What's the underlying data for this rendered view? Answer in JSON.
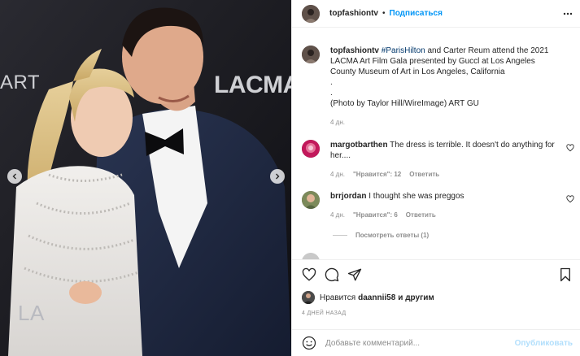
{
  "post": {
    "author": "topfashiontv",
    "follow_label": "Подписаться",
    "separator": "•",
    "caption_user": "topfashiontv",
    "caption_tag": "#ParisHilton",
    "caption_text": " and Carter Reum attend the 2021 LACMA Art Film Gala presented by Guccl at Los Angeles County Museum of Art in Los Angeles, California",
    "caption_dot1": ".",
    "caption_dot2": ".",
    "caption_credit": "(Photo by Taylor Hill/WireImage) ART GU",
    "caption_time": "4 дн.",
    "photo_wall_left": "ART",
    "photo_wall_right": "LACMA",
    "photo_wall_bottom": "LA"
  },
  "comments": [
    {
      "user": "margotbarthen",
      "text": "The dress is terrible. It doesn't do anything for her....",
      "time": "4 дн.",
      "likes": "\"Нравится\": 12",
      "reply": "Ответить"
    },
    {
      "user": "brrjordan",
      "text": "I thought she was preggos",
      "time": "4 дн.",
      "likes": "\"Нравится\": 6",
      "reply": "Ответить"
    }
  ],
  "view_replies": "Посмотреть ответы (1)",
  "likes_bar": {
    "prefix": "Нравится",
    "user": "daannii58",
    "suffix": "и другим"
  },
  "date_label": "4 ДНЕЙ НАЗАД",
  "comment_box": {
    "placeholder": "Добавьте комментарий...",
    "publish_label": "Опубликовать"
  },
  "icons": {
    "like": "heart-icon",
    "comment": "comment-icon",
    "share": "paper-plane-icon",
    "save": "bookmark-icon",
    "more": "more-horizontal-icon",
    "emoji": "emoji-icon"
  },
  "colors": {
    "link": "#0095f6",
    "hashtag": "#00376b",
    "muted": "#8e8e8e",
    "publish_disabled": "#b2dffc"
  }
}
